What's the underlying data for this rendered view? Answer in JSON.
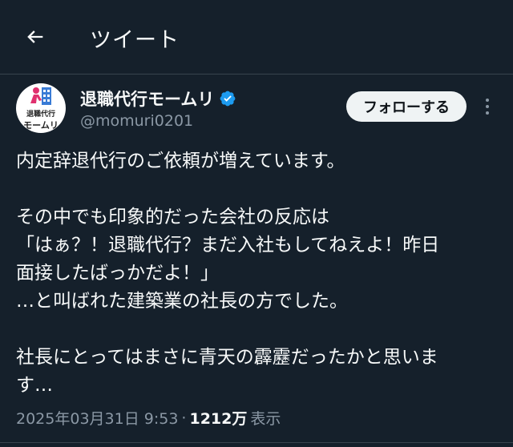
{
  "header": {
    "title": "ツイート"
  },
  "author": {
    "display_name": "退職代行モームリ",
    "handle": "@momuri0201",
    "avatar_line1": "退職代行",
    "avatar_line2": "モームリ"
  },
  "follow_button": {
    "label": "フォローする"
  },
  "tweet": {
    "lines": [
      "内定辞退代行のご依頼が増えています。",
      "",
      "その中でも印象的だった会社の反応は",
      "「はぁ？！退職代行？まだ入社もしてねえよ！昨日",
      "面接したばっかだよ！」",
      "…と叫ばれた建築業の社長の方でした。",
      "",
      "社長にとってはまさに青天の霹靂だったかと思いま",
      "す…"
    ]
  },
  "meta": {
    "timestamp": "2025年03月31日 9:53",
    "separator": "·",
    "views": "1212万",
    "views_label": "表示"
  },
  "colors": {
    "background": "#15202b",
    "text": "#f7f9f9",
    "secondary": "#8b98a5",
    "verified": "#1d9bf0",
    "divider": "#38444d"
  }
}
